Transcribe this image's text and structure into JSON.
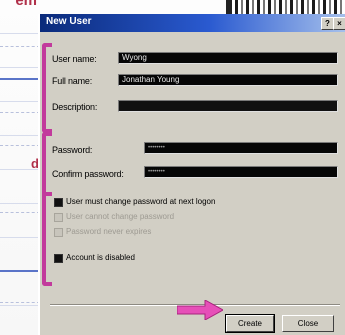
{
  "slide": {
    "title_fragment": "em",
    "side_fragment": "d"
  },
  "dialog": {
    "title": "New User",
    "help_glyph": "?",
    "close_glyph": "×",
    "fields": {
      "user_name": {
        "label": "User name:",
        "value": "Wyong"
      },
      "full_name": {
        "label": "Full name:",
        "value": "Jonathan Young"
      },
      "description": {
        "label": "Description:",
        "value": ""
      },
      "password": {
        "label": "Password:",
        "value": "••••••••"
      },
      "confirm_password": {
        "label": "Confirm password:",
        "value": "••••••••"
      }
    },
    "options": [
      {
        "label": "User must change password at next logon",
        "checked": true,
        "enabled": true
      },
      {
        "label": "User cannot change password",
        "checked": false,
        "enabled": false
      },
      {
        "label": "Password never expires",
        "checked": false,
        "enabled": false
      },
      {
        "label": "Account is disabled",
        "checked": true,
        "enabled": true
      }
    ],
    "buttons": {
      "create": "Create",
      "close": "Close"
    }
  },
  "colors": {
    "annotation": "#c23a9c",
    "titlebar": "#0a2a7a"
  }
}
